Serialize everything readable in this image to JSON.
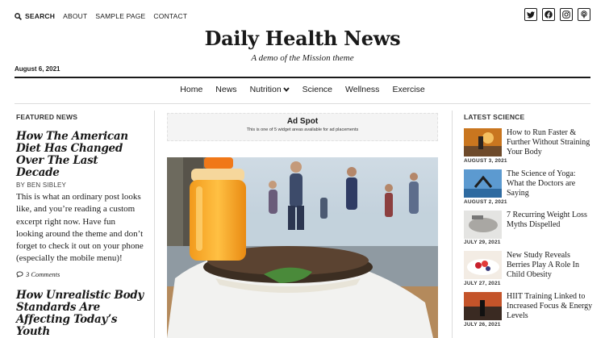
{
  "topnav": {
    "search": "SEARCH",
    "links": [
      "ABOUT",
      "SAMPLE PAGE",
      "CONTACT"
    ]
  },
  "social": [
    "twitter-icon",
    "facebook-icon",
    "instagram-icon",
    "podcast-icon"
  ],
  "site": {
    "title": "Daily Health News",
    "tagline": "A demo of the Mission theme",
    "date": "August 6, 2021"
  },
  "mainnav": [
    "Home",
    "News",
    "Nutrition",
    "Science",
    "Wellness",
    "Exercise"
  ],
  "featured": {
    "label": "FEATURED NEWS",
    "post1": {
      "title": "How The American Diet Has Changed Over The Last Decade",
      "byline": "BY BEN SIBLEY",
      "excerpt": "This is what an ordinary post looks like, and you’re reading a custom excerpt right now. Have fun looking around the theme and don’t forget to check it out on your phone (especially the mobile menu)!",
      "comments": "3 Comments"
    },
    "post2": {
      "title": "How Unrealistic Body Standards Are Affecting Today’s Youth"
    }
  },
  "ad": {
    "title": "Ad Spot",
    "text": "This is one of 5 widget areas available for ad placements"
  },
  "science": {
    "label": "LATEST SCIENCE",
    "items": [
      {
        "title": "How to Run Faster & Further Without Straining Your Body",
        "date": "AUGUST 3, 2021"
      },
      {
        "title": "The Science of Yoga: What the Doctors are Saying",
        "date": "AUGUST 2, 2021"
      },
      {
        "title": "7 Recurring Weight Loss Myths Dispelled",
        "date": "JULY 29, 2021"
      },
      {
        "title": "New Study Reveals Berries Play A Role In Child Obesity",
        "date": "JULY 27, 2021"
      },
      {
        "title": "HIIT Training Linked to Increased Focus & Energy Levels",
        "date": "JULY 26, 2021"
      }
    ]
  },
  "colors": {
    "text": "#1a1a1a",
    "rule": "#dcdcdc",
    "ad_bg": "#f4f4f4"
  }
}
